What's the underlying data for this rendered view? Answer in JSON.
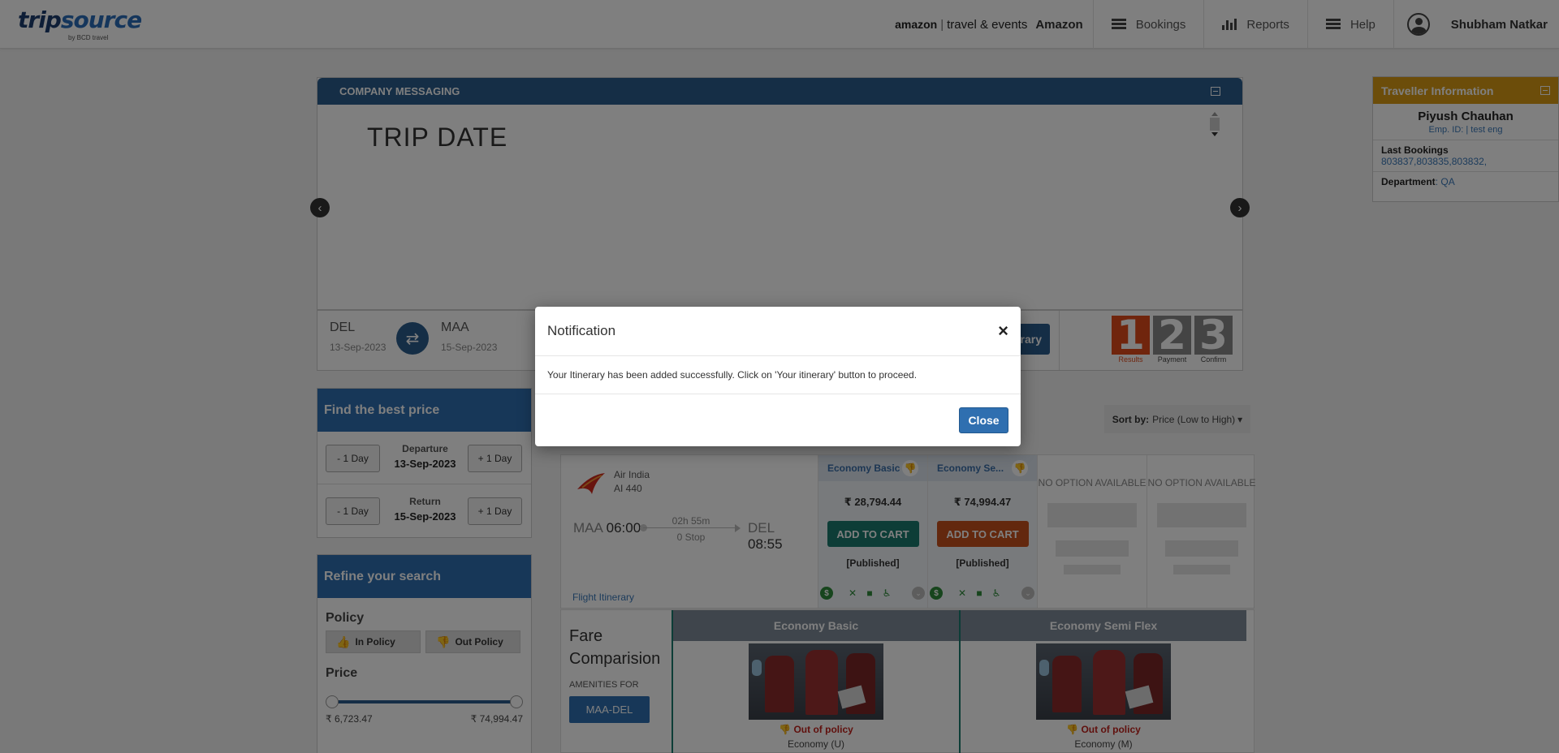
{
  "header": {
    "logo_main": "trip",
    "logo_accent": "source",
    "logo_sub": "by BCD travel",
    "partner_brand": "amazon",
    "partner_divider": "|",
    "partner_unit": "travel & events",
    "company": "Amazon",
    "nav": [
      {
        "label": "Bookings",
        "icon": "list-icon"
      },
      {
        "label": "Reports",
        "icon": "bar-chart-icon"
      },
      {
        "label": "Help",
        "icon": "menu-icon"
      }
    ],
    "user_name": "Shubham Natkar"
  },
  "company_messaging": {
    "title": "COMPANY MESSAGING",
    "content_heading": "TRIP DATE"
  },
  "search": {
    "origin_code": "DEL",
    "origin_date": "13-Sep-2023",
    "dest_code": "MAA",
    "dest_date": "15-Sep-2023",
    "itinerary_btn_partial": "rary",
    "steps": [
      {
        "num": "1",
        "label": "Results"
      },
      {
        "num": "2",
        "label": "Payment"
      },
      {
        "num": "3",
        "label": "Confirm"
      }
    ]
  },
  "traveller": {
    "title": "Traveller Information",
    "name": "Piyush Chauhan",
    "emp_label": "Emp. ID:",
    "emp_value": "| test eng",
    "last_bookings_label": "Last Bookings",
    "last_bookings_value": "803837,803835,803832,",
    "department_label": "Department",
    "department_value": ": QA"
  },
  "best_price": {
    "title": "Find the best price",
    "minus_label": "- 1 Day",
    "plus_label": "+ 1 Day",
    "departure_label": "Departure",
    "departure_date": "13-Sep-2023",
    "return_label": "Return",
    "return_date": "15-Sep-2023"
  },
  "refine": {
    "title": "Refine your search",
    "policy_title": "Policy",
    "in_policy": "In Policy",
    "out_policy": "Out Policy",
    "price_title": "Price",
    "price_min": "₹ 6,723.47",
    "price_max": "₹ 74,994.47"
  },
  "sort": {
    "label": "Sort by:",
    "value": "Price (Low to High)"
  },
  "flight": {
    "airline": "Air India",
    "flight_no": "AI  440",
    "dep_code": "MAA",
    "dep_time": "06:00",
    "arr_code": "DEL",
    "arr_time": "08:55",
    "duration": "02h 55m",
    "stops": "0 Stop",
    "itinerary_link": "Flight Itinerary",
    "fares": [
      {
        "name": "Economy Basic",
        "price": "₹ 28,794.44",
        "button": "ADD TO CART",
        "type": "[Published]"
      },
      {
        "name": "Economy Se...",
        "price": "₹ 74,994.47",
        "button": "ADD TO CART",
        "type": "[Published]"
      }
    ],
    "no_option": "NO OPTION AVAILABLE"
  },
  "fare_comparison": {
    "title_line1": "Fare",
    "title_line2": "Comparision",
    "amenities_for": "AMENITIES FOR",
    "route_btn": "MAA-DEL",
    "columns": [
      {
        "name": "Economy Basic",
        "policy": "Out of policy",
        "cabin": "Economy (U)"
      },
      {
        "name": "Economy Semi Flex",
        "policy": "Out of policy",
        "cabin": "Economy (M)"
      }
    ]
  },
  "modal": {
    "title": "Notification",
    "close_x": "×",
    "message": "Your Itinerary has been added successfully. Click on 'Your itinerary' button to proceed.",
    "close_btn": "Close"
  },
  "colors": {
    "primary": "#2f6fb0",
    "header_dark": "#2b5d8c",
    "traveller_head": "#d89a14",
    "add_cart_green": "#1a7a6e",
    "add_cart_orange": "#c6501c",
    "out_policy_red": "#c0201b"
  }
}
